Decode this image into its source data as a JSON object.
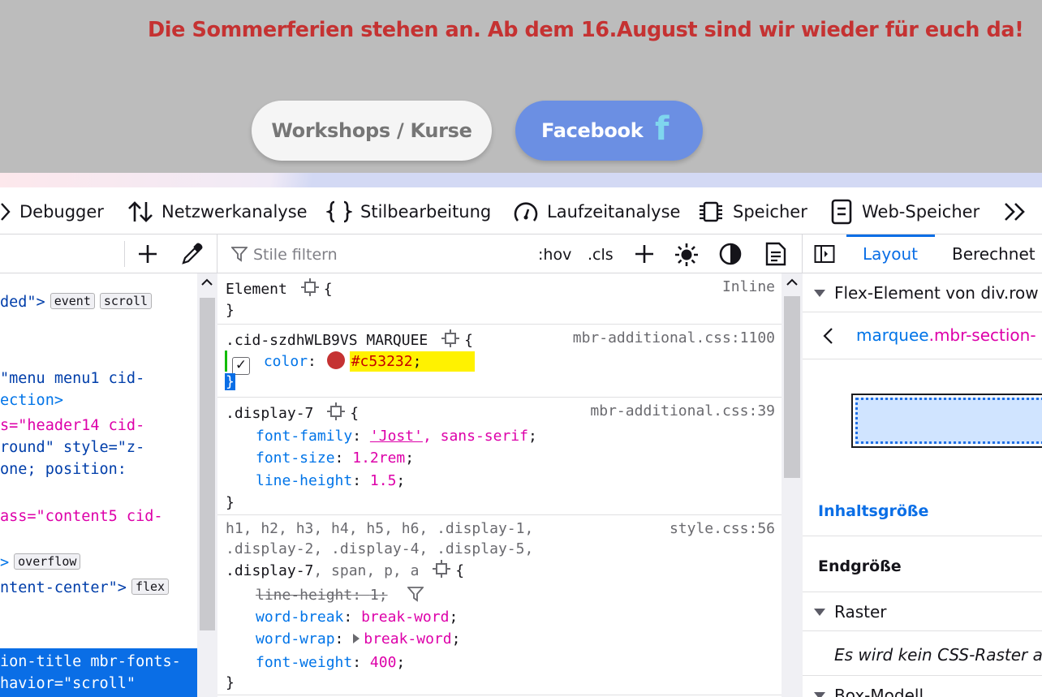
{
  "preview": {
    "marquee_text": "Die Sommerferien stehen an. Ab dem 16.August sind wir wieder für euch da!",
    "button_workshops": "Workshops / Kurse",
    "button_facebook": "Facebook",
    "facebook_glyph": "f",
    "colors": {
      "background": "#bcbcbc",
      "marquee": "#c53232",
      "facebook_button": "#6b8fe3"
    }
  },
  "tabs": [
    {
      "label": "Debugger",
      "icon": "chevron-right-icon"
    },
    {
      "label": "Netzwerkanalyse",
      "icon": "arrows-updown-icon"
    },
    {
      "label": "Stilbearbeitung",
      "icon": "braces-icon"
    },
    {
      "label": "Laufzeitanalyse",
      "icon": "gauge-icon"
    },
    {
      "label": "Speicher",
      "icon": "chip-icon"
    },
    {
      "label": "Web-Speicher",
      "icon": "storage-icon"
    }
  ],
  "markup": {
    "lines": [
      {
        "p1": "ded\">",
        "badge": "event",
        "badge2": "scroll"
      },
      {
        "p1": "\"menu menu1 cid-"
      },
      {
        "p1": "ection>"
      },
      {
        "p1": "s=\"header14 cid-"
      },
      {
        "p1": "round\" style=\"z-"
      },
      {
        "p1": "one; position:"
      },
      {
        "p1": "ass=\"content5 cid-"
      },
      {
        "p1": ">",
        "badge": "overflow"
      },
      {
        "p1": "ntent-center\">",
        "badge": "flex"
      },
      {
        "p1": "ion-title mbr-fonts-"
      },
      {
        "p1": "havior=\"scroll\""
      }
    ]
  },
  "rules": {
    "filter_placeholder": "Stile filtern",
    "hov": ":hov",
    "cls": ".cls",
    "element_selector": "Element",
    "element_source": "Inline",
    "rule1": {
      "selector": ".cid-szdhWLB9VS MARQUEE",
      "source": "mbr-additional.css:1100",
      "prop": "color",
      "value": "#c53232",
      "swatch": "#c53232"
    },
    "rule2": {
      "selector": ".display-7",
      "source": "mbr-additional.css:39",
      "decls": [
        {
          "prop": "font-family",
          "value_a": "'Jost'",
          "value_b": ", sans-serif"
        },
        {
          "prop": "font-size",
          "value": "1.2rem"
        },
        {
          "prop": "line-height",
          "value": "1.5"
        }
      ]
    },
    "rule3": {
      "selector_line1": "h1, h2, h3, h4, h5, h6, .display-1,",
      "selector_line2": ".display-2, .display-4, .display-5,",
      "selector_line3_a": ".display-7",
      "selector_line3_b": ", span, p, a",
      "source": "style.css:56",
      "decls": [
        {
          "prop": "line-height",
          "value": "1"
        },
        {
          "prop": "word-break",
          "value": "break-word"
        },
        {
          "prop": "word-wrap",
          "value": "break-word"
        },
        {
          "prop": "font-weight",
          "value": "400"
        }
      ]
    }
  },
  "layout": {
    "tab_layout": "Layout",
    "tab_computed": "Berechnet",
    "flex_item_header": "Flex-Element von div.row",
    "breadcrumb_tag": "marquee",
    "breadcrumb_class": ".mbr-section-",
    "content_size": "Inhaltsgröße",
    "final_size": "Endgröße",
    "grid_header": "Raster",
    "no_grid": "Es wird kein CSS-Raster au",
    "box_model_header": "Box-Modell"
  }
}
